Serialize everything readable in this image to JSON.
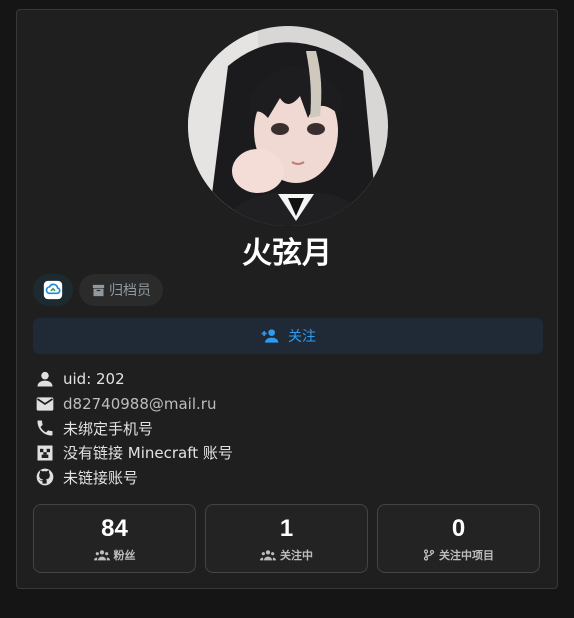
{
  "profile": {
    "display_name": "火弦月",
    "avatar_alt": "user-avatar"
  },
  "badges": {
    "archivist_label": "归档员"
  },
  "follow_button": {
    "label": "关注"
  },
  "info": {
    "uid": "uid: 202",
    "email": "d82740988@mail.ru",
    "phone": "未绑定手机号",
    "minecraft": "没有链接 Minecraft 账号",
    "github": "未链接账号"
  },
  "stats": [
    {
      "value": "84",
      "label": "粉丝",
      "icon": "group-icon"
    },
    {
      "value": "1",
      "label": "关注中",
      "icon": "group-icon"
    },
    {
      "value": "0",
      "label": "关注中项目",
      "icon": "fork-icon"
    }
  ],
  "colors": {
    "background": "#151515",
    "card": "#1f1f1f",
    "accent": "#2f9bf0",
    "follow_button_bg": "#1f2a36"
  }
}
